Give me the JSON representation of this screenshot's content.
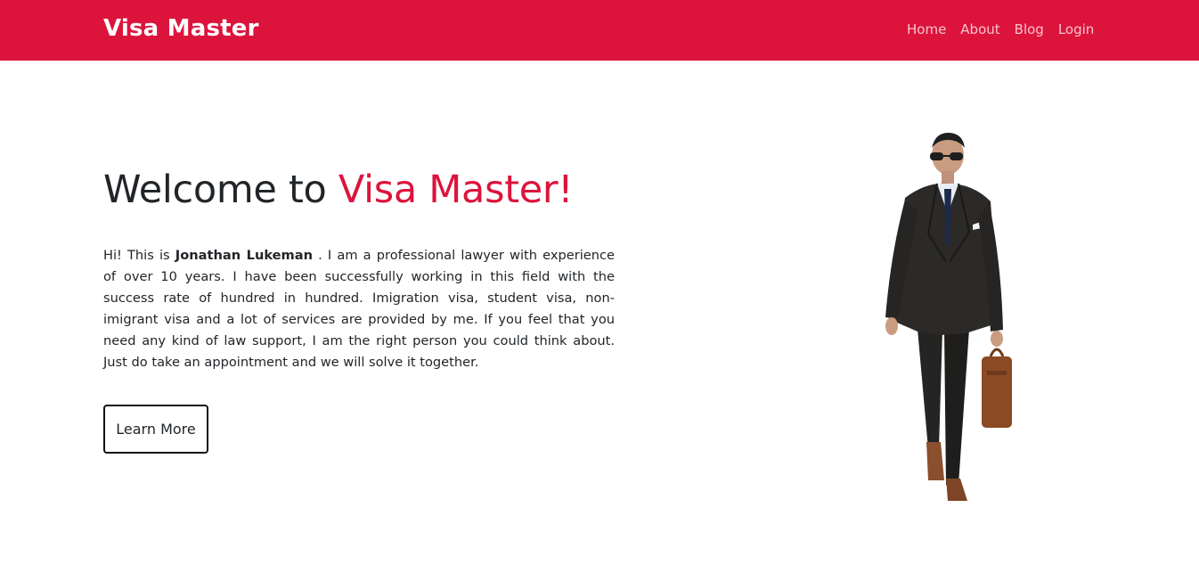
{
  "navbar": {
    "brand": "Visa Master",
    "links": [
      "Home",
      "About",
      "Blog",
      "Login"
    ]
  },
  "hero": {
    "title_prefix": "Welcome to ",
    "title_accent": "Visa Master!",
    "bio_prefix": "Hi! This is ",
    "bio_name": "Jonathan Lukeman",
    "bio_suffix": " . I am a professional lawyer with experience of over 10 years. I have been successfully working in this field with the success rate of hundred in hundred. Imigration visa, student visa, non-imigrant visa and a lot of services are provided by me. If you feel that you need any kind of law support, I am the right person you could think about. Just do take an appointment and we will solve it together.",
    "button_label": "Learn More"
  },
  "colors": {
    "brand": "#dc143c",
    "text": "#212529",
    "background": "#ffffff"
  },
  "icons": {
    "hero_image": "businessman-walking-photo"
  }
}
